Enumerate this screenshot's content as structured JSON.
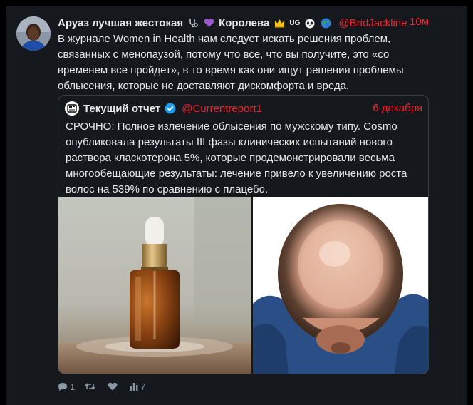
{
  "author": {
    "name": "Аруаз лучшая жестокая",
    "suffix": "Королева",
    "badge_ug": "UG",
    "handle": "@BridJackline",
    "time": "10м"
  },
  "tweet": {
    "text": "В журнале Women in Health нам следует искать решения проблем, связанных с менопаузой, потому что все, что вы получите, это «со временем все пройдет», в то время как они ищут решения проблемы облысения, которые не доставляют дискомфорта и вреда."
  },
  "quote": {
    "name": "Текущий отчет",
    "handle": "@Currentreport1",
    "date": "6 декабря",
    "text": "СРОЧНО: Полное излечение облысения по мужскому типу. Cosmo опубликовала результаты III фазы клинических испытаний нового раствора класкотерона 5%, которые продемонстрировали весьма многообещающие результаты: лечение привело к увеличению роста волос на 539% по сравнению с плацебо."
  },
  "actions": {
    "reply_count": "1",
    "retweet_count": "",
    "like_count": "",
    "views_count": "7"
  },
  "colors": {
    "accent": "#f4212e",
    "background": "#15181c",
    "text": "#e7e9ea",
    "muted": "#8b98a5",
    "verified": "#1d9bf0"
  }
}
